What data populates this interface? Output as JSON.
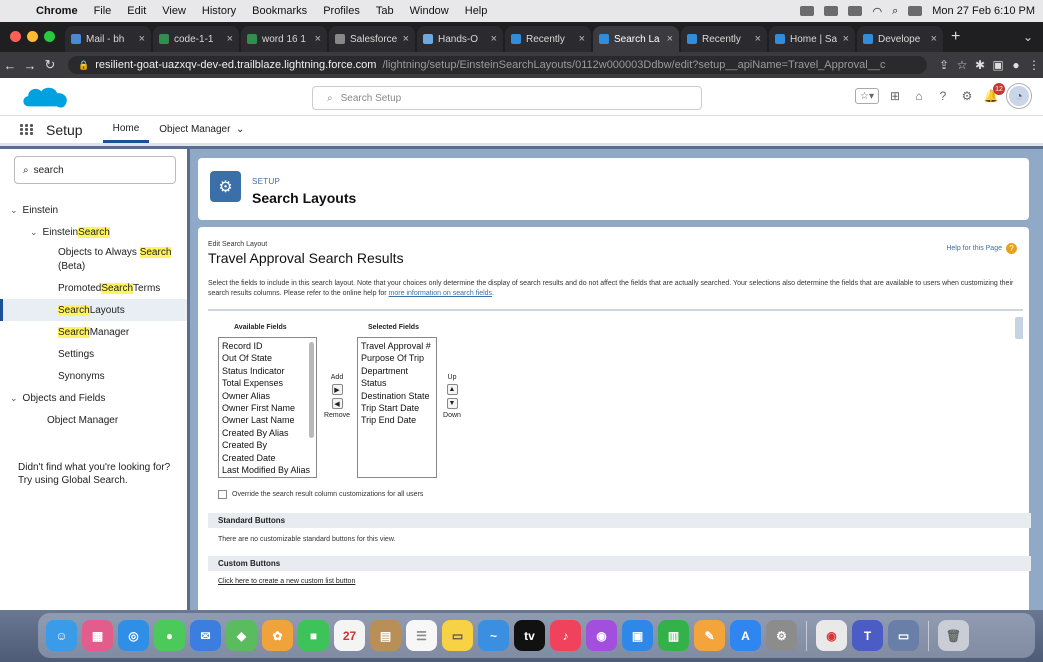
{
  "menubar": {
    "app": "Chrome",
    "items": [
      "File",
      "Edit",
      "View",
      "History",
      "Bookmarks",
      "Profiles",
      "Tab",
      "Window",
      "Help"
    ],
    "clock": "Mon 27 Feb 6:10 PM"
  },
  "tabs": [
    {
      "title": "Mail - bh",
      "active": false
    },
    {
      "title": "code-1-1",
      "active": false
    },
    {
      "title": "word 16 1",
      "active": false
    },
    {
      "title": "Salesforce",
      "active": false
    },
    {
      "title": "Hands-O",
      "active": false
    },
    {
      "title": "Recently",
      "active": false
    },
    {
      "title": "Search La",
      "active": true
    },
    {
      "title": "Recently",
      "active": false
    },
    {
      "title": "Home | Sa",
      "active": false
    },
    {
      "title": "Develope",
      "active": false
    }
  ],
  "address": {
    "host": "resilient-goat-uazxqv-dev-ed.trailblaze.lightning.force.com",
    "path": "/lightning/setup/EinsteinSearchLayouts/0112w000003Ddbw/edit?setup__apiName=Travel_Approval__c"
  },
  "header": {
    "search_placeholder": "Search Setup",
    "notification_count": "12"
  },
  "setupnav": {
    "app": "Setup",
    "home": "Home",
    "object_manager": "Object Manager"
  },
  "sidebar": {
    "quickfind": "search",
    "einstein": "Einstein",
    "einstein_search_pre": "Einstein ",
    "einstein_search_hl": "Search",
    "objects_pre": "Objects to Always ",
    "objects_hl": "Search",
    "objects_post": "(Beta)",
    "promoted_pre": "Promoted ",
    "promoted_hl": "Search",
    "promoted_post": " Terms",
    "layouts_hl": "Search",
    "layouts_post": " Layouts",
    "manager_hl": "Search",
    "manager_post": " Manager",
    "settings": "Settings",
    "synonyms": "Synonyms",
    "objects_and_fields": "Objects and Fields",
    "object_manager": "Object Manager",
    "help_line1": "Didn't find what you're looking for?",
    "help_line2": "Try using Global Search."
  },
  "page": {
    "eyebrow": "SETUP",
    "title": "Search Layouts"
  },
  "editor": {
    "label": "Edit Search Layout",
    "title": "Travel Approval Search Results",
    "help_link": "Help for this Page",
    "description": "Select the fields to include in this search layout. Note that your choices only determine the display of search results and do not affect the fields that are actually searched. Your selections also determine the fields that are available to users when customizing their search results columns. Please refer to the online help for ",
    "description_link": "more information on search fields",
    "description_end": ".",
    "available_label": "Available Fields",
    "selected_label": "Selected Fields",
    "available": [
      "Record ID",
      "Out Of State",
      "Status Indicator",
      "Total Expenses",
      "Owner Alias",
      "Owner First Name",
      "Owner Last Name",
      "Created By Alias",
      "Created By",
      "Created Date",
      "Last Modified By Alias"
    ],
    "selected": [
      "Travel Approval #",
      "Purpose Of Trip",
      "Department",
      "Status",
      "Destination State",
      "Trip Start Date",
      "Trip End Date"
    ],
    "add": "Add",
    "remove": "Remove",
    "up": "Up",
    "down": "Down",
    "override": "Override the search result column customizations for all users",
    "std_buttons": "Standard Buttons",
    "std_text": "There are no customizable standard buttons for this view.",
    "custom_buttons": "Custom Buttons",
    "custom_link": "Click here to create a new custom list button"
  }
}
